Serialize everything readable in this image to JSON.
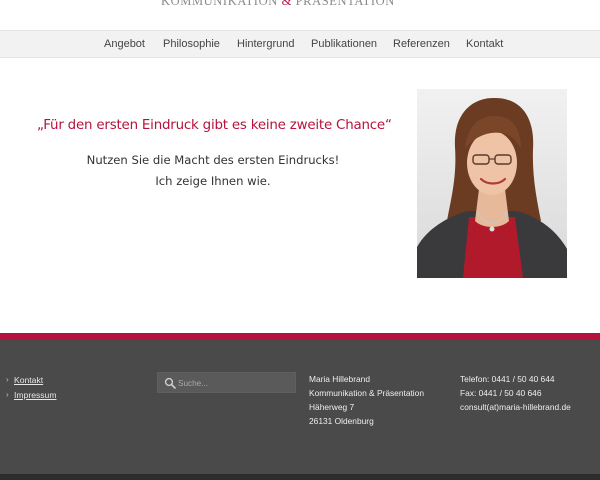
{
  "header": {
    "logo_part1": "Kommunikation",
    "logo_amp": "&",
    "logo_part2": "Präsentation"
  },
  "nav": {
    "items": [
      {
        "label": "Angebot"
      },
      {
        "label": "Philosophie"
      },
      {
        "label": "Hintergrund"
      },
      {
        "label": "Publikationen"
      },
      {
        "label": "Referenzen"
      },
      {
        "label": "Kontakt"
      }
    ]
  },
  "hero": {
    "quote": "„Für den ersten Eindruck gibt es keine zweite Chance“",
    "line1": "Nutzen Sie die Macht des ersten Eindrucks!",
    "line2": "Ich zeige Ihnen wie."
  },
  "footer": {
    "links": [
      {
        "label": "Kontakt"
      },
      {
        "label": "Impressum"
      }
    ],
    "search": {
      "placeholder": "Suche..."
    },
    "address": {
      "name": "Maria Hillebrand",
      "company": "Kommunikation & Präsentation",
      "street": "Häherweg 7",
      "city": "26131 Oldenburg"
    },
    "contact": {
      "phone": "Telefon: 0441 / 50 40 644",
      "fax": "Fax: 0441 / 50 40 646",
      "email": "consult(at)maria-hillebrand.de"
    }
  },
  "colors": {
    "accent": "#b5123c",
    "footer_bg": "#4a4a4a",
    "nav_bg": "#f2f2f2"
  }
}
